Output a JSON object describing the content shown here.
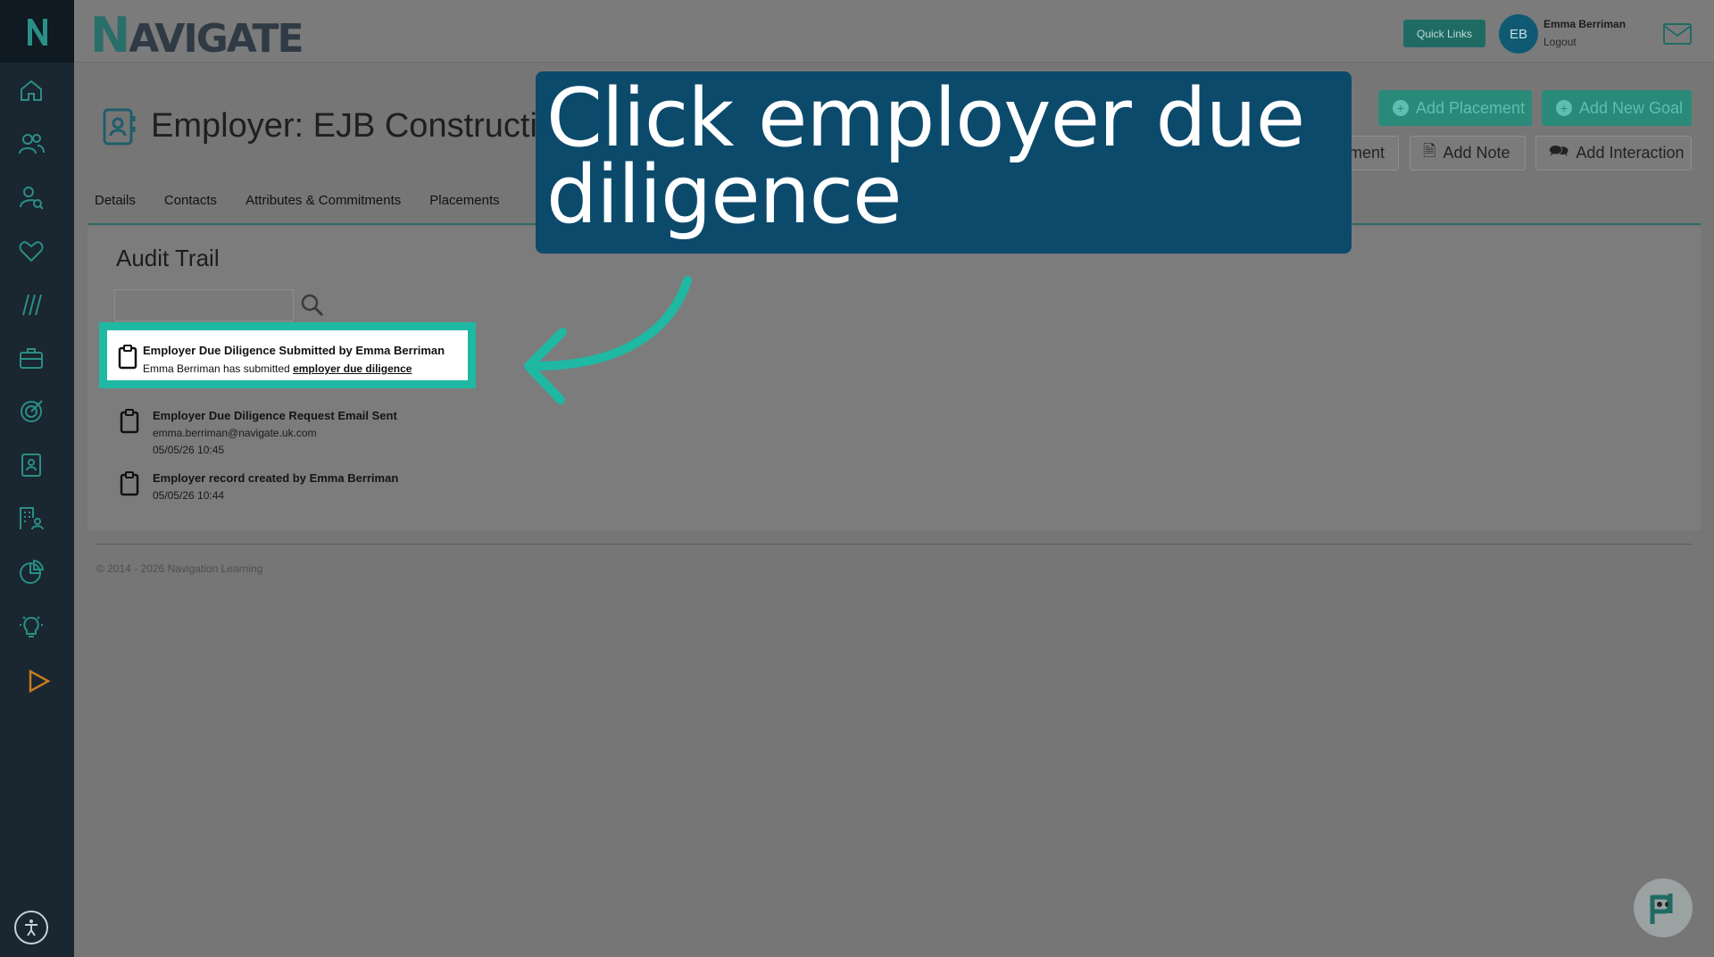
{
  "header": {
    "brand": "NAVIGATE",
    "quick_links": "Quick Links",
    "avatar_initials": "EB",
    "user_name": "Emma Berriman",
    "logout": "Logout"
  },
  "page": {
    "title": "Employer: EJB Constructio",
    "buttons": {
      "add_placement": "Add Placement",
      "add_new_goal": "Add New Goal",
      "partial_e": "e",
      "partial_ment": "ment",
      "add_note": "Add Note",
      "add_interaction": "Add Interaction"
    },
    "tabs": [
      "Details",
      "Contacts",
      "Attributes & Commitments",
      "Placements"
    ]
  },
  "audit": {
    "title": "Audit Trail",
    "entries": [
      {
        "title": "Employer Due Diligence Submitted by Emma Berriman",
        "sub_prefix": "Emma Berriman has submitted ",
        "sub_link": "employer due diligence"
      },
      {
        "title": "Employer Due Diligence Request Email Sent",
        "sub": "emma.berriman@navigate.uk.com",
        "time": "05/05/26 10:45"
      },
      {
        "title": "Employer record created by Emma Berriman",
        "time": "05/05/26 10:44"
      }
    ]
  },
  "footer": "© 2014 - 2026 Navigation Learning",
  "callout": "Click employer due diligence",
  "colors": {
    "sidebar": "#1a2630",
    "accent": "#1fb8a3",
    "callout": "#0c4a6c",
    "green_button": "#2a8a7a"
  },
  "sidebar_icons": [
    "home-icon",
    "users-icon",
    "user-search-icon",
    "heart-icon",
    "slashes-icon",
    "briefcase-icon",
    "target-icon",
    "contact-card-icon",
    "building-user-icon",
    "pie-chart-icon",
    "lightbulb-icon",
    "play-icon",
    "accessibility-icon"
  ]
}
